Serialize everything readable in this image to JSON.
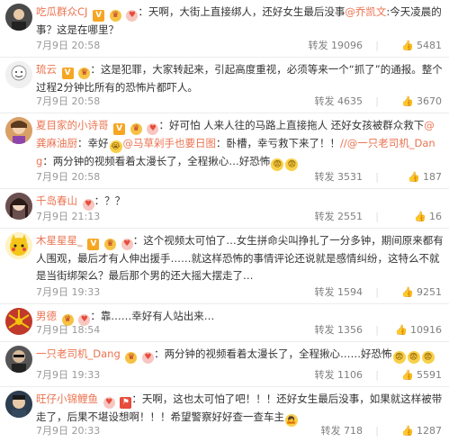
{
  "comments": [
    {
      "username": "吃瓜群众CJ",
      "text": "天啊，大街上直接绑人，还好女生最后没事",
      "mention": "@乔凯文",
      "text2": ":今天凌晨的事？这是在哪里？",
      "time": "7月9日 20:58",
      "repost": "转发 19096",
      "likes": "5481",
      "avatar_color": "#4a4a4a"
    },
    {
      "username": "琉云",
      "text": "这是犯罪，大家转起来，引起高度重视，必须等来一个“抓了”的通报。整个过程2分钟比所有的恐怖片都吓人。",
      "time": "7月9日 20:58",
      "repost": "转发 4635",
      "likes": "3670",
      "avatar_color": "#e0e0e0"
    },
    {
      "username": "夏目家的小诗哥",
      "text": "好可怕 人来人往的马路上直接拖人 还好女孩被群众救下",
      "mention": "@龚麻油厨",
      "text2": "：幸好",
      "mention2": "@马草剁手也要日图",
      "text3": "：卧槽，幸亏救下来了！！",
      "mention3": "//@一只老司机_Dang",
      "text4": "：两分钟的视频看着太漫长了，全程揪心…好恐怖",
      "time": "7月9日 20:58",
      "repost": "转发 3531",
      "likes": "187",
      "avatar_color": "#a0522d"
    },
    {
      "username": "千岛春山",
      "text": "？？",
      "time": "7月9日 21:13",
      "repost": "转发 2551",
      "likes": "16",
      "avatar_color": "#6b4f4f"
    },
    {
      "username": "木星星星_",
      "text": "这个视频太可怕了…女生拼命尖叫挣扎了一分多钟，期间原来都有人围观，最后才有人伸出援手……就这样恐怖的事情评论还说就是感情纠纷，这特么不就是当街绑架么？最后那个男的还大摇大摆走了…",
      "time": "7月9日 19:33",
      "repost": "转发 1594",
      "likes": "9251",
      "avatar_color": "#f5c518"
    },
    {
      "username": "男德",
      "text": "靠……幸好有人站出来…",
      "time": "7月9日 18:54",
      "repost": "转发 1356",
      "likes": "10916",
      "avatar_color": "#c0392b"
    },
    {
      "username": "一只老司机_Dang",
      "text": "两分钟的视频看着太漫长了，全程揪心……好恐怖",
      "time": "7月9日 19:33",
      "repost": "转发 1106",
      "likes": "5591",
      "avatar_color": "#555555"
    },
    {
      "username": "旺仔小锦鲤鱼",
      "text": "天啊，这也太可怕了吧！！！还好女生最后没事，如果就这样被带走了，后果不堪设想啊！！！希望警察好好查一查车主",
      "time": "7月9日 20:33",
      "repost": "转发 718",
      "likes": "1287",
      "avatar_color": "#2c3e50"
    }
  ]
}
